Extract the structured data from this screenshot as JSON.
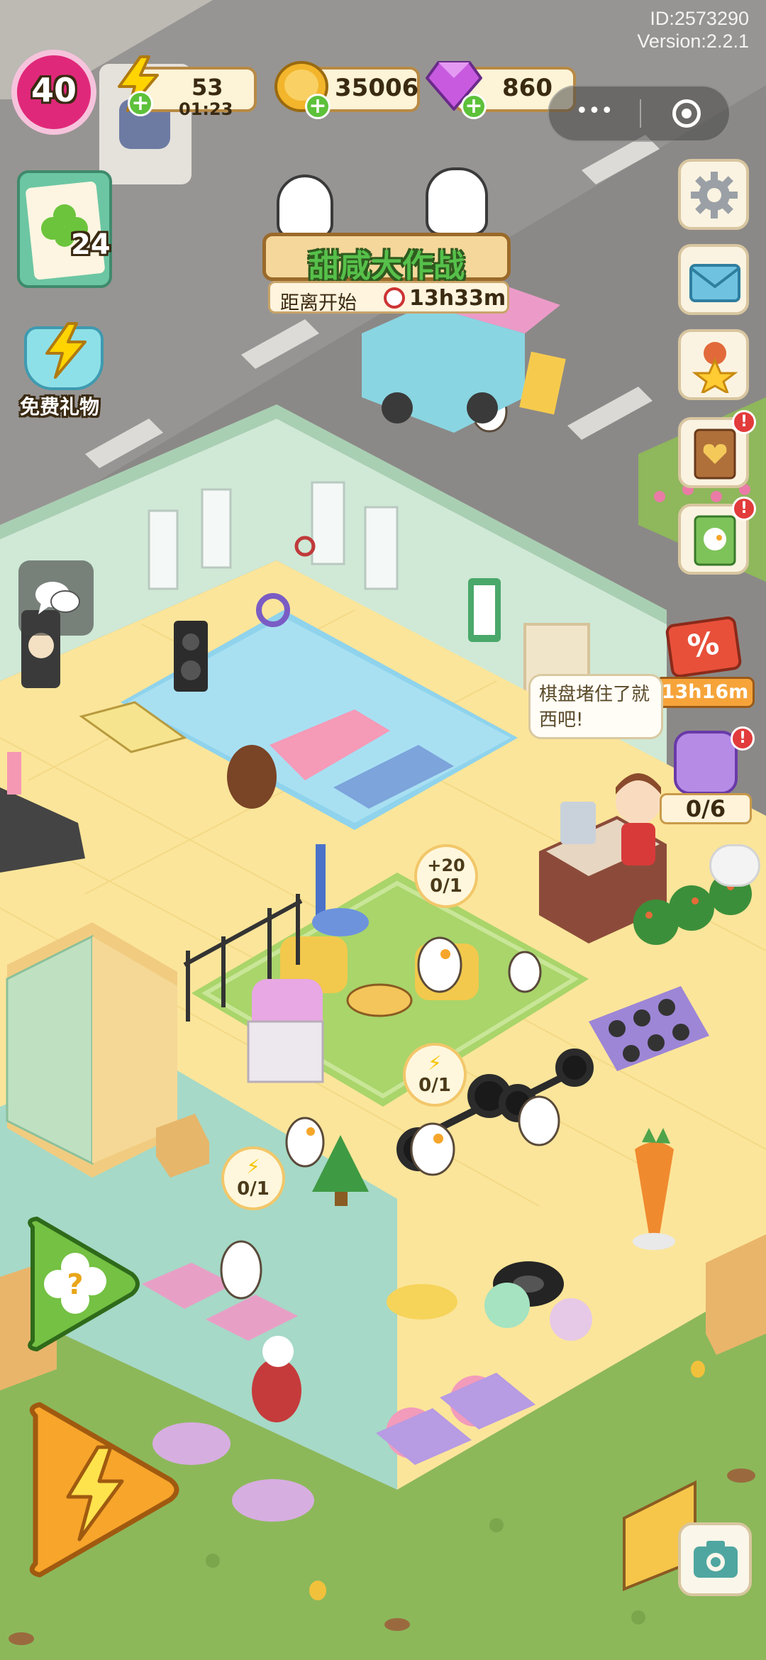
{
  "account": {
    "id": "ID:2573290",
    "version": "Version:2.2.1"
  },
  "player": {
    "level": "40"
  },
  "resources": {
    "energy": {
      "value": "53",
      "timer": "01:23",
      "icon": "lightning-icon"
    },
    "coins": {
      "value": "35006",
      "icon": "coin-icon"
    },
    "gems": {
      "value": "860",
      "icon": "gem-icon"
    }
  },
  "mini_program": {
    "more": "•••",
    "close_icon": "target-circle-icon"
  },
  "task_board": {
    "count": "24"
  },
  "free_gift": {
    "label": "免费礼物"
  },
  "event": {
    "title": "甜咸大作战",
    "countdown_label": "距离开始",
    "countdown": "13h33m"
  },
  "sale": {
    "timer": "13h16m",
    "symbol": "%"
  },
  "jar": {
    "progress": "0/6"
  },
  "chat": {
    "message": "棋盘堵住了就西吧!"
  },
  "bubbles": [
    {
      "reward": "+20",
      "progress": "0/1"
    },
    {
      "progress": "0/1"
    },
    {
      "progress": "0/1"
    }
  ],
  "side_icons": [
    "gear-icon",
    "mail-icon",
    "medal-icon",
    "heart-book-icon",
    "duck-book-icon"
  ],
  "colors": {
    "accent_green": "#5dc13a",
    "level_pink": "#e0287a",
    "alert_red": "#e23b3b",
    "floor_yellow": "#fbe59a",
    "rug_green": "#a9d56a"
  }
}
